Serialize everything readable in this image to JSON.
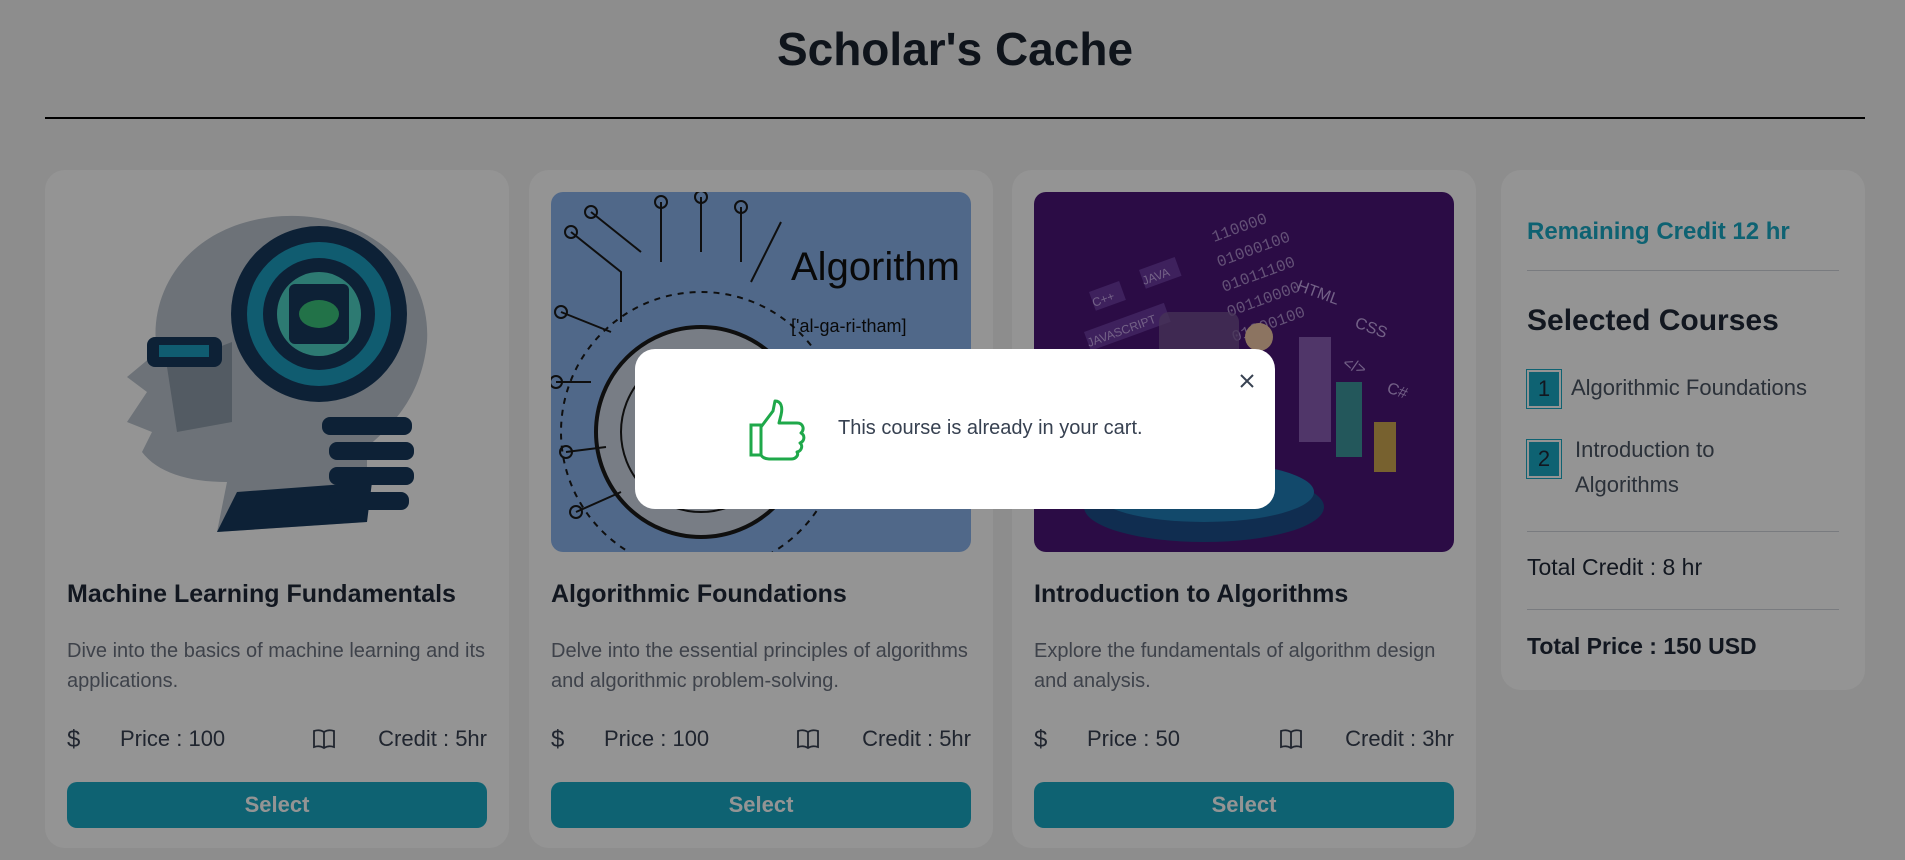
{
  "site": {
    "title": "Scholar's Cache"
  },
  "courses": [
    {
      "title": "Machine Learning Fundamentals",
      "description": "Dive into the basics of machine learning and its applications.",
      "price": "Price : 100",
      "credit": "Credit : 5hr",
      "select_label": "Select",
      "image": "ai-head-illustration"
    },
    {
      "title": "Algorithmic Foundations",
      "description": "Delve into the essential principles of algorithms and algorithmic problem-solving.",
      "price": "Price : 100",
      "credit": "Credit : 5hr",
      "select_label": "Select",
      "image": "algorithm-circuit-illustration",
      "image_text": {
        "word": "Algorithm",
        "phonetic": "['al-ga-ri-tham]"
      }
    },
    {
      "title": "Introduction to Algorithms",
      "description": "Explore the fundamentals of algorithm design and analysis.",
      "price": "Price : 50",
      "credit": "Credit : 3hr",
      "select_label": "Select",
      "image": "isometric-coding-illustration",
      "image_text": {
        "langs": [
          "C++",
          "JAVA",
          "JAVASCRIPT",
          "HTML",
          "CSS",
          "</>",
          "C#"
        ],
        "binary": [
          "110000",
          "01000100",
          "01011100",
          "00110000",
          "01000100"
        ]
      }
    }
  ],
  "sidebar": {
    "remaining": "Remaining Credit 12 hr",
    "heading": "Selected Courses",
    "items": [
      {
        "num": "1",
        "name": "Algorithmic Foundations"
      },
      {
        "num": "2",
        "name": "Introduction to Algorithms"
      }
    ],
    "total_credit": "Total Credit : 8 hr",
    "total_price": "Total Price : 150 USD"
  },
  "modal": {
    "message": "This course is already in your cart.",
    "icon": "thumbs-up-icon"
  },
  "icons": {
    "currency": "$",
    "book": "book-icon",
    "close": "close-icon"
  },
  "colors": {
    "accent": "#19a9c5",
    "overlay": "rgba(0,0,0,0.42)",
    "card2_bg": "#8bb4ec",
    "card3_bg": "#4a1577"
  }
}
